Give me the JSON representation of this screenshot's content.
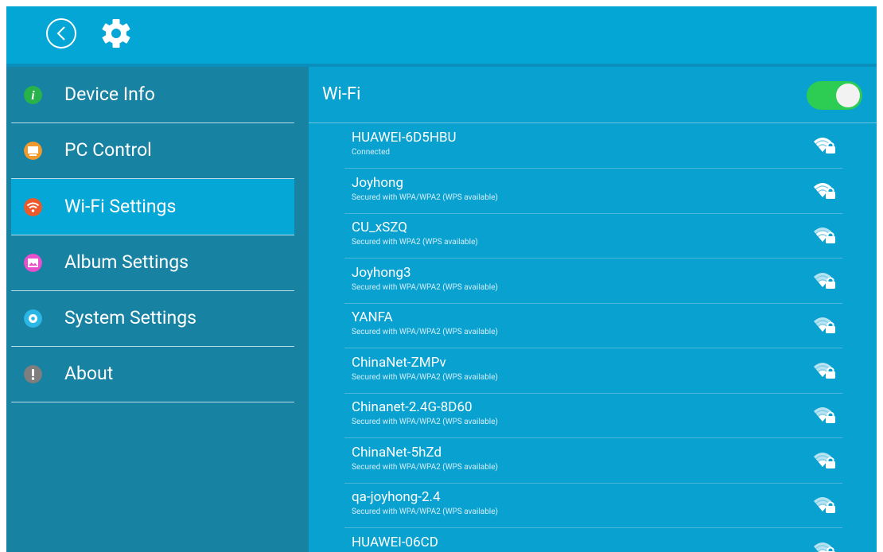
{
  "topbar": {
    "back_icon": "chevron-left-circle-icon",
    "settings_icon": "gear-icon"
  },
  "sidebar": {
    "items": [
      {
        "label": "Device Info",
        "icon": "info-icon",
        "color": "#27b34a",
        "active": false
      },
      {
        "label": "PC Control",
        "icon": "monitor-icon",
        "color": "#f2992e",
        "active": false
      },
      {
        "label": "Wi-Fi Settings",
        "icon": "wifi-icon",
        "color": "#ec5a2b",
        "active": true
      },
      {
        "label": "Album Settings",
        "icon": "image-icon",
        "color": "#e74fcd",
        "active": false
      },
      {
        "label": "System Settings",
        "icon": "gear-icon",
        "color": "#2ab7e5",
        "active": false
      },
      {
        "label": "About",
        "icon": "alert-icon",
        "color": "#7e7e7e",
        "active": false
      }
    ]
  },
  "wifi": {
    "title": "Wi-Fi",
    "enabled": true,
    "networks": [
      {
        "name": "HUAWEI-6D5HBU",
        "status": "Connected",
        "strength": 1.0
      },
      {
        "name": "Joyhong",
        "status": "Secured with WPA/WPA2 (WPS available)",
        "strength": 1.0
      },
      {
        "name": "CU_xSZQ",
        "status": "Secured with WPA2 (WPS available)",
        "strength": 0.75
      },
      {
        "name": "Joyhong3",
        "status": "Secured with WPA/WPA2 (WPS available)",
        "strength": 0.5
      },
      {
        "name": "YANFA",
        "status": "Secured with WPA/WPA2 (WPS available)",
        "strength": 0.5
      },
      {
        "name": "ChinaNet-ZMPv",
        "status": "Secured with WPA/WPA2 (WPS available)",
        "strength": 0.5
      },
      {
        "name": "Chinanet-2.4G-8D60",
        "status": "Secured with WPA/WPA2 (WPS available)",
        "strength": 0.5
      },
      {
        "name": "ChinaNet-5hZd",
        "status": "Secured with WPA/WPA2 (WPS available)",
        "strength": 0.5
      },
      {
        "name": "qa-joyhong-2.4",
        "status": "Secured with WPA/WPA2 (WPS available)",
        "strength": 0.5
      },
      {
        "name": "HUAWEI-06CD",
        "status": "",
        "strength": 0.5
      }
    ]
  }
}
